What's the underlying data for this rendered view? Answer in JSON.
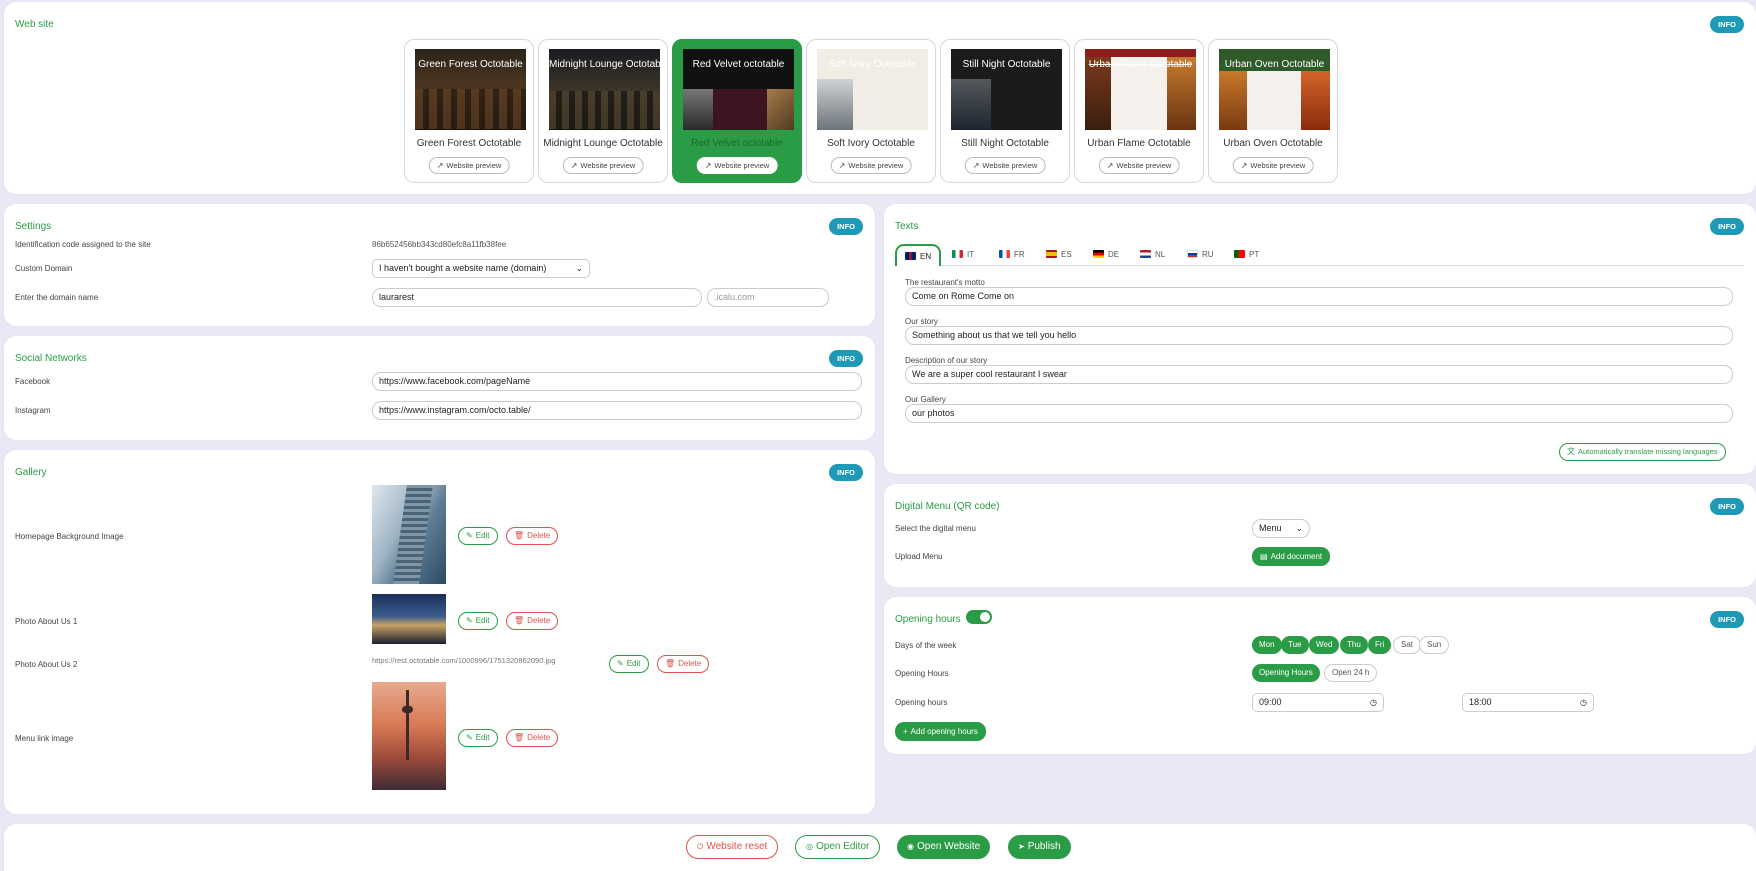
{
  "website": {
    "title": "Web site",
    "info_label": "INFO",
    "preview_label": "Website preview",
    "templates": [
      {
        "name": "Green Forest Octotable",
        "thumb_title": "Green Forest Octotable"
      },
      {
        "name": "Midnight Lounge Octotable",
        "thumb_title": "Midnight Lounge Octotable"
      },
      {
        "name": "Red Velvet octotable",
        "thumb_title": "Red Velvet octotable"
      },
      {
        "name": "Soft Ivory Octotable",
        "thumb_title": "Soft Ivory Octotable"
      },
      {
        "name": "Still Night Octotable",
        "thumb_title": "Still Night Octotable"
      },
      {
        "name": "Urban Flame Octotable",
        "thumb_title": "Urban Flame Octotable"
      },
      {
        "name": "Urban Oven Octotable",
        "thumb_title": "Urban Oven Octotable"
      }
    ]
  },
  "settings": {
    "title": "Settings",
    "info_label": "INFO",
    "id_label": "Identification code assigned to the site",
    "id_value": "86b652456bb343cd80efc8a11fb38fee",
    "domain_label": "Custom Domain",
    "domain_select": "I haven't bought a website name (domain)",
    "domain_name_label": "Enter the domain name",
    "domain_name_value": "laurarest",
    "domain_suffix_placeholder": ".icalu.com"
  },
  "social": {
    "title": "Social Networks",
    "info_label": "INFO",
    "facebook_label": "Facebook",
    "facebook_value": "https://www.facebook.com/pageName",
    "instagram_label": "Instagram",
    "instagram_value": "https://www.instagram.com/octo.table/"
  },
  "gallery": {
    "title": "Gallery",
    "info_label": "INFO",
    "edit_label": "Edit",
    "delete_label": "Delete",
    "items": [
      {
        "label": "Homepage Background Image"
      },
      {
        "label": "Photo About Us 1"
      },
      {
        "label": "Photo About Us 2",
        "broken_alt": "https://rest.octotable.com/1000996/1751320862090.jpg"
      },
      {
        "label": "Menu link image"
      }
    ]
  },
  "texts": {
    "title": "Texts",
    "info_label": "INFO",
    "tabs": [
      {
        "code": "EN",
        "flag": "uk-flag-icon"
      },
      {
        "code": "IT",
        "flag": "italy-flag-icon"
      },
      {
        "code": "FR",
        "flag": "france-flag-icon"
      },
      {
        "code": "ES",
        "flag": "spain-flag-icon"
      },
      {
        "code": "DE",
        "flag": "germany-flag-icon"
      },
      {
        "code": "NL",
        "flag": "netherlands-flag-icon"
      },
      {
        "code": "RU",
        "flag": "russia-flag-icon"
      },
      {
        "code": "PT",
        "flag": "portugal-flag-icon"
      }
    ],
    "fields": [
      {
        "label": "The restaurant's motto",
        "value": "Come on Rome Come on"
      },
      {
        "label": "Our story",
        "value": "Something about us that we tell you hello"
      },
      {
        "label": "Description of our story",
        "value": "We are a super cool restaurant I swear"
      },
      {
        "label": "Our Gallery",
        "value": "our photos"
      }
    ],
    "translate_label": "Automatically translate missing languages"
  },
  "digital_menu": {
    "title": "Digital Menu (QR code)",
    "info_label": "INFO",
    "select_label": "Select the digital menu",
    "select_value": "Menu",
    "upload_label": "Upload Menu",
    "add_document_label": "Add document"
  },
  "opening_hours": {
    "title": "Opening hours",
    "info_label": "INFO",
    "enabled": true,
    "days_label": "Days of the week",
    "days": [
      {
        "label": "Mon",
        "on": true
      },
      {
        "label": "Tue",
        "on": true
      },
      {
        "label": "Wed",
        "on": true
      },
      {
        "label": "Thu",
        "on": true
      },
      {
        "label": "Fri",
        "on": true
      },
      {
        "label": "Sat",
        "on": false
      },
      {
        "label": "Sun",
        "on": false
      }
    ],
    "mode_label": "Opening Hours",
    "mode_options": [
      "Opening Hours",
      "Open 24 h"
    ],
    "hours_label": "Opening hours",
    "from": "09:00",
    "to": "18:00",
    "add_label": "Add opening hours"
  },
  "footer": {
    "reset_label": "Website reset",
    "editor_label": "Open Editor",
    "open_label": "Open Website",
    "publish_label": "Publish"
  },
  "colors": {
    "accent": "#2a9c46",
    "info": "#1e9ab6",
    "danger": "#d9534f",
    "background": "#e9e9f6"
  }
}
